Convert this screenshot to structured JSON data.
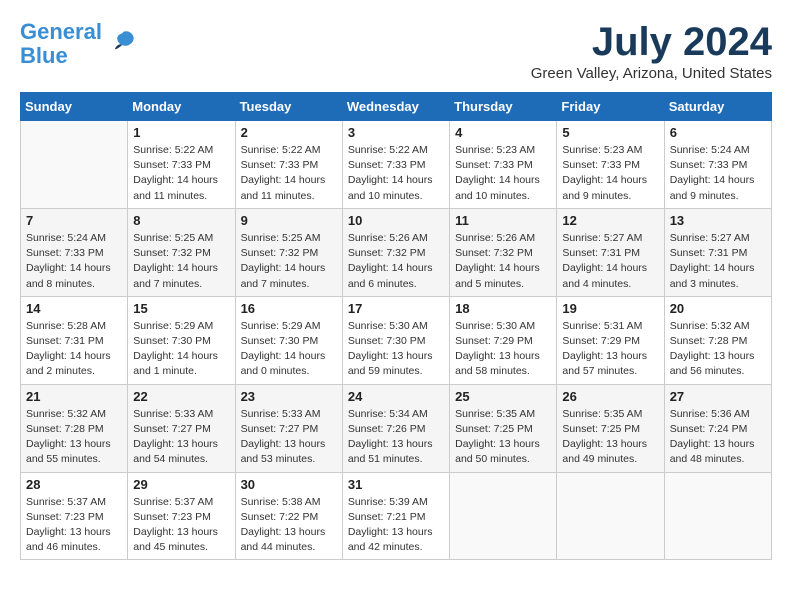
{
  "header": {
    "logo_line1": "General",
    "logo_line2": "Blue",
    "month_year": "July 2024",
    "location": "Green Valley, Arizona, United States"
  },
  "days_of_week": [
    "Sunday",
    "Monday",
    "Tuesday",
    "Wednesday",
    "Thursday",
    "Friday",
    "Saturday"
  ],
  "weeks": [
    [
      {
        "day": "",
        "info": ""
      },
      {
        "day": "1",
        "info": "Sunrise: 5:22 AM\nSunset: 7:33 PM\nDaylight: 14 hours\nand 11 minutes."
      },
      {
        "day": "2",
        "info": "Sunrise: 5:22 AM\nSunset: 7:33 PM\nDaylight: 14 hours\nand 11 minutes."
      },
      {
        "day": "3",
        "info": "Sunrise: 5:22 AM\nSunset: 7:33 PM\nDaylight: 14 hours\nand 10 minutes."
      },
      {
        "day": "4",
        "info": "Sunrise: 5:23 AM\nSunset: 7:33 PM\nDaylight: 14 hours\nand 10 minutes."
      },
      {
        "day": "5",
        "info": "Sunrise: 5:23 AM\nSunset: 7:33 PM\nDaylight: 14 hours\nand 9 minutes."
      },
      {
        "day": "6",
        "info": "Sunrise: 5:24 AM\nSunset: 7:33 PM\nDaylight: 14 hours\nand 9 minutes."
      }
    ],
    [
      {
        "day": "7",
        "info": "Sunrise: 5:24 AM\nSunset: 7:33 PM\nDaylight: 14 hours\nand 8 minutes."
      },
      {
        "day": "8",
        "info": "Sunrise: 5:25 AM\nSunset: 7:32 PM\nDaylight: 14 hours\nand 7 minutes."
      },
      {
        "day": "9",
        "info": "Sunrise: 5:25 AM\nSunset: 7:32 PM\nDaylight: 14 hours\nand 7 minutes."
      },
      {
        "day": "10",
        "info": "Sunrise: 5:26 AM\nSunset: 7:32 PM\nDaylight: 14 hours\nand 6 minutes."
      },
      {
        "day": "11",
        "info": "Sunrise: 5:26 AM\nSunset: 7:32 PM\nDaylight: 14 hours\nand 5 minutes."
      },
      {
        "day": "12",
        "info": "Sunrise: 5:27 AM\nSunset: 7:31 PM\nDaylight: 14 hours\nand 4 minutes."
      },
      {
        "day": "13",
        "info": "Sunrise: 5:27 AM\nSunset: 7:31 PM\nDaylight: 14 hours\nand 3 minutes."
      }
    ],
    [
      {
        "day": "14",
        "info": "Sunrise: 5:28 AM\nSunset: 7:31 PM\nDaylight: 14 hours\nand 2 minutes."
      },
      {
        "day": "15",
        "info": "Sunrise: 5:29 AM\nSunset: 7:30 PM\nDaylight: 14 hours\nand 1 minute."
      },
      {
        "day": "16",
        "info": "Sunrise: 5:29 AM\nSunset: 7:30 PM\nDaylight: 14 hours\nand 0 minutes."
      },
      {
        "day": "17",
        "info": "Sunrise: 5:30 AM\nSunset: 7:30 PM\nDaylight: 13 hours\nand 59 minutes."
      },
      {
        "day": "18",
        "info": "Sunrise: 5:30 AM\nSunset: 7:29 PM\nDaylight: 13 hours\nand 58 minutes."
      },
      {
        "day": "19",
        "info": "Sunrise: 5:31 AM\nSunset: 7:29 PM\nDaylight: 13 hours\nand 57 minutes."
      },
      {
        "day": "20",
        "info": "Sunrise: 5:32 AM\nSunset: 7:28 PM\nDaylight: 13 hours\nand 56 minutes."
      }
    ],
    [
      {
        "day": "21",
        "info": "Sunrise: 5:32 AM\nSunset: 7:28 PM\nDaylight: 13 hours\nand 55 minutes."
      },
      {
        "day": "22",
        "info": "Sunrise: 5:33 AM\nSunset: 7:27 PM\nDaylight: 13 hours\nand 54 minutes."
      },
      {
        "day": "23",
        "info": "Sunrise: 5:33 AM\nSunset: 7:27 PM\nDaylight: 13 hours\nand 53 minutes."
      },
      {
        "day": "24",
        "info": "Sunrise: 5:34 AM\nSunset: 7:26 PM\nDaylight: 13 hours\nand 51 minutes."
      },
      {
        "day": "25",
        "info": "Sunrise: 5:35 AM\nSunset: 7:25 PM\nDaylight: 13 hours\nand 50 minutes."
      },
      {
        "day": "26",
        "info": "Sunrise: 5:35 AM\nSunset: 7:25 PM\nDaylight: 13 hours\nand 49 minutes."
      },
      {
        "day": "27",
        "info": "Sunrise: 5:36 AM\nSunset: 7:24 PM\nDaylight: 13 hours\nand 48 minutes."
      }
    ],
    [
      {
        "day": "28",
        "info": "Sunrise: 5:37 AM\nSunset: 7:23 PM\nDaylight: 13 hours\nand 46 minutes."
      },
      {
        "day": "29",
        "info": "Sunrise: 5:37 AM\nSunset: 7:23 PM\nDaylight: 13 hours\nand 45 minutes."
      },
      {
        "day": "30",
        "info": "Sunrise: 5:38 AM\nSunset: 7:22 PM\nDaylight: 13 hours\nand 44 minutes."
      },
      {
        "day": "31",
        "info": "Sunrise: 5:39 AM\nSunset: 7:21 PM\nDaylight: 13 hours\nand 42 minutes."
      },
      {
        "day": "",
        "info": ""
      },
      {
        "day": "",
        "info": ""
      },
      {
        "day": "",
        "info": ""
      }
    ]
  ]
}
